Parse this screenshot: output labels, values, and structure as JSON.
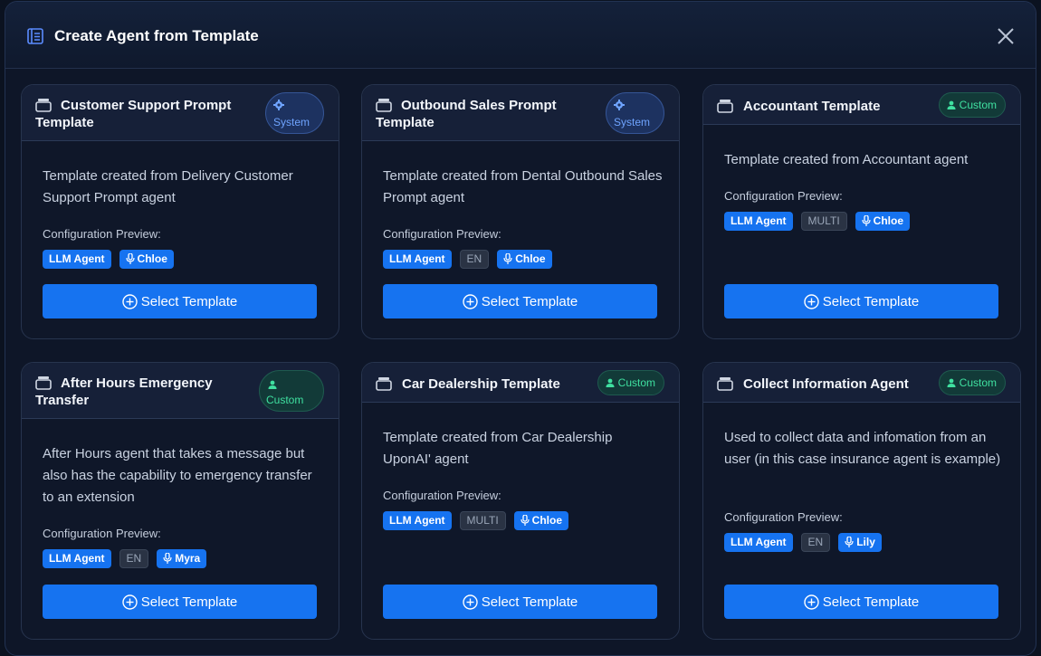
{
  "modal": {
    "title": "Create Agent from Template"
  },
  "cards": [
    {
      "title_line1": "Customer Support Prompt",
      "title_line2": "Template",
      "badge": "System",
      "description": "Template created from Delivery Customer Support Prompt agent",
      "config_label": "Configuration Preview:",
      "chip_type": "LLM Agent",
      "chip_lang": "",
      "chip_voice": "Chloe",
      "button_label": "Select Template"
    },
    {
      "title_line1": "Outbound Sales Prompt",
      "title_line2": "Template",
      "badge": "System",
      "description": "Template created from Dental Outbound Sales Prompt agent",
      "config_label": "Configuration Preview:",
      "chip_type": "LLM Agent",
      "chip_lang": "EN",
      "chip_voice": "Chloe",
      "button_label": "Select Template"
    },
    {
      "title_line1": "Accountant Template",
      "title_line2": "",
      "badge": "Custom",
      "description": "Template created from Accountant agent",
      "config_label": "Configuration Preview:",
      "chip_type": "LLM Agent",
      "chip_lang": "MULTI",
      "chip_voice": "Chloe",
      "button_label": "Select Template"
    },
    {
      "title_line1": "After Hours Emergency",
      "title_line2": "Transfer",
      "badge": "Custom",
      "description": "After Hours agent that takes a message but also has the capability to emergency transfer to an extension",
      "config_label": "Configuration Preview:",
      "chip_type": "LLM Agent",
      "chip_lang": "EN",
      "chip_voice": "Myra",
      "button_label": "Select Template"
    },
    {
      "title_line1": "Car Dealership Template",
      "title_line2": "",
      "badge": "Custom",
      "description": "Template created from Car Dealership UponAI' agent",
      "config_label": "Configuration Preview:",
      "chip_type": "LLM Agent",
      "chip_lang": "MULTI",
      "chip_voice": "Chloe",
      "button_label": "Select Template"
    },
    {
      "title_line1": "Collect Information Agent",
      "title_line2": "",
      "badge": "Custom",
      "description": "Used to collect data and infomation from an user (in this case insurance agent is example)",
      "config_label": "Configuration Preview:",
      "chip_type": "LLM Agent",
      "chip_lang": "EN",
      "chip_voice": "Lily",
      "button_label": "Select Template"
    }
  ],
  "colors": {
    "accent": "#1673f0",
    "system_badge": "#6fa4ff",
    "custom_badge": "#3fe0a0"
  }
}
